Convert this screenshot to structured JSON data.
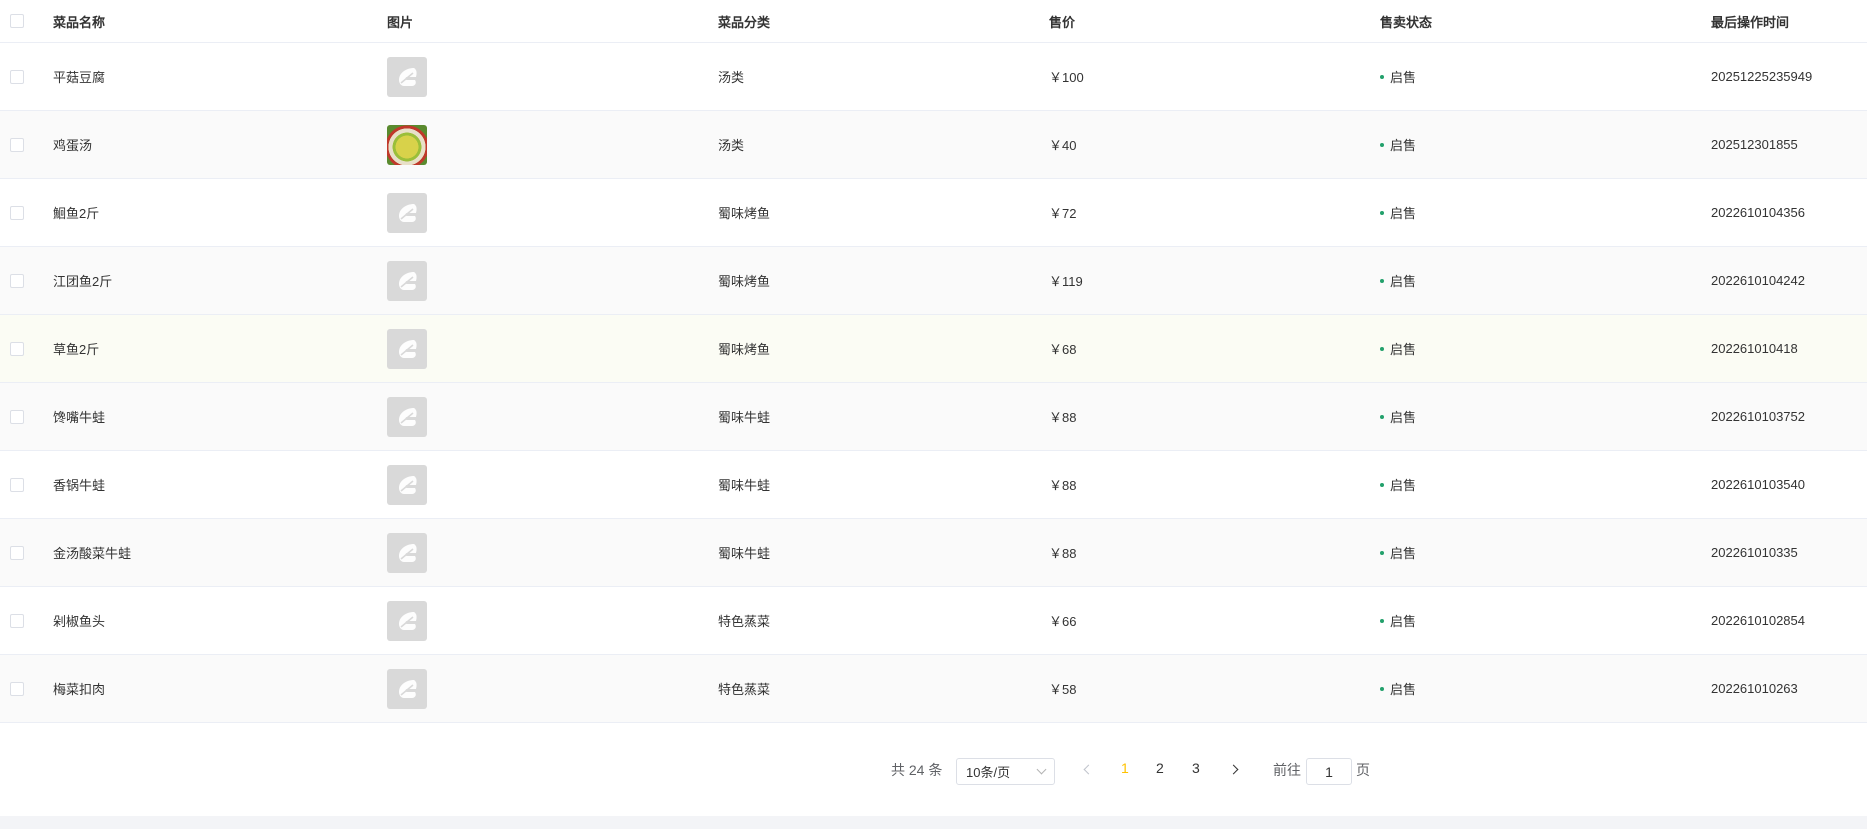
{
  "table": {
    "headers": {
      "name": "菜品名称",
      "image": "图片",
      "category": "菜品分类",
      "price": "售价",
      "status": "售卖状态",
      "time": "最后操作时间"
    },
    "rows": [
      {
        "name": "平菇豆腐",
        "category": "汤类",
        "price": "￥100",
        "status": "启售",
        "time": "20251225235949",
        "image": "placeholder-logo"
      },
      {
        "name": "鸡蛋汤",
        "category": "汤类",
        "price": "￥40",
        "status": "启售",
        "time": "202512301855",
        "image": "dish-photo"
      },
      {
        "name": "鮰鱼2斤",
        "category": "蜀味烤鱼",
        "price": "￥72",
        "status": "启售",
        "time": "2022610104356",
        "image": "placeholder-logo"
      },
      {
        "name": "江团鱼2斤",
        "category": "蜀味烤鱼",
        "price": "￥119",
        "status": "启售",
        "time": "2022610104242",
        "image": "placeholder-logo"
      },
      {
        "name": "草鱼2斤",
        "category": "蜀味烤鱼",
        "price": "￥68",
        "status": "启售",
        "time": "202261010418",
        "image": "placeholder-logo"
      },
      {
        "name": "馋嘴牛蛙",
        "category": "蜀味牛蛙",
        "price": "￥88",
        "status": "启售",
        "time": "2022610103752",
        "image": "placeholder-logo"
      },
      {
        "name": "香锅牛蛙",
        "category": "蜀味牛蛙",
        "price": "￥88",
        "status": "启售",
        "time": "2022610103540",
        "image": "placeholder-logo"
      },
      {
        "name": "金汤酸菜牛蛙",
        "category": "蜀味牛蛙",
        "price": "￥88",
        "status": "启售",
        "time": "202261010335",
        "image": "placeholder-logo"
      },
      {
        "name": "剁椒鱼头",
        "category": "特色蒸菜",
        "price": "￥66",
        "status": "启售",
        "time": "2022610102854",
        "image": "placeholder-logo"
      },
      {
        "name": "梅菜扣肉",
        "category": "特色蒸菜",
        "price": "￥58",
        "status": "启售",
        "time": "202261010263",
        "image": "placeholder-logo"
      }
    ]
  },
  "pagination": {
    "total": "共 24 条",
    "page_size": "10条/页",
    "pages": [
      "1",
      "2",
      "3"
    ],
    "current": "1",
    "goto_label": "前往",
    "goto_value": "1",
    "page_suffix": "页",
    "active_color": "#ffc200"
  },
  "colors": {
    "status_dot": "#22a06b",
    "stripe": "#fafafa",
    "highlight": "#fbfcf4"
  }
}
